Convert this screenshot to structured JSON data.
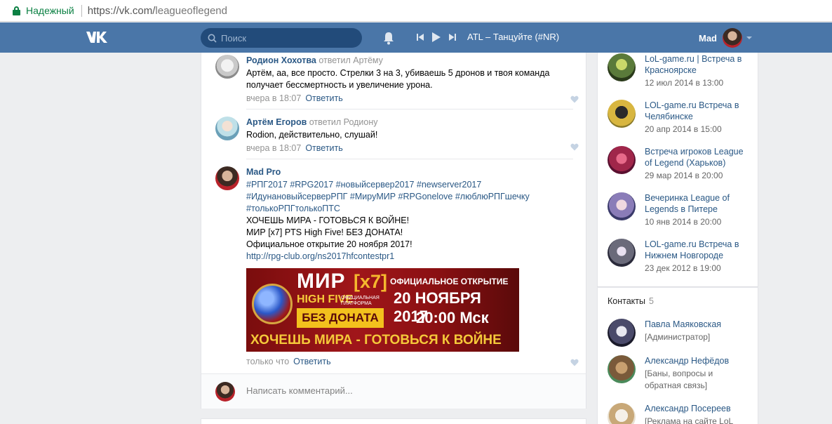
{
  "browser": {
    "secure_label": "Надежный",
    "url_host": "https://vk.com/",
    "url_path": "leagueoflegend"
  },
  "header": {
    "search_placeholder": "Поиск",
    "track": "ATL – Танцуйте (#NR)",
    "user_name": "Mad"
  },
  "comments": [
    {
      "author": "Родион Хохотва",
      "replied": "ответил Артёму",
      "lines": [
        "Артём, аа, все просто. Стрелки 3 на 3, убиваешь 5 дронов и твоя команда",
        "получает бессмертность и увеличение урона."
      ],
      "time": "вчера в 18:07",
      "reply_label": "Ответить"
    },
    {
      "author": "Артём Егоров",
      "replied": "ответил Родиону",
      "lines": [
        "Rodion, действительно, слушай!"
      ],
      "time": "вчера в 18:07",
      "reply_label": "Ответить"
    },
    {
      "author": "Mad Pro",
      "tags_line1": "#РПГ2017 #RPG2017 #новыйсервер2017 #newserver2017",
      "tags_line2": "#ИдунановыйсерверРПГ #МируМИР #RPGonelove #люблюРПГшечку",
      "tags_line3": "#толькоРПГтолькоПТС",
      "lines": [
        "ХОЧЕШЬ МИРА - ГОТОВЬСЯ К ВОЙНЕ!",
        "МИР [x7] PTS High Five! БЕЗ ДОНАТА!",
        "Официальное открытие 20 ноября 2017!"
      ],
      "link": "http://rpg-club.org/ns2017hfcontestpr1",
      "time": "только что",
      "reply_label": "Ответить"
    }
  ],
  "banner": {
    "mir": "МИР",
    "x7": "[x7]",
    "high_five": "HIGH FIVE",
    "platform": "ОФИЦИАЛЬНАЯ ПЛАТФОРМА",
    "no_donate": "БЕЗ ДОНАТА",
    "opening": "ОФИЦИАЛЬНОЕ ОТКРЫТИЕ",
    "date": "20 НОЯБРЯ 2017",
    "time": "20:00 Мск",
    "slogan": "ХОЧЕШЬ МИРА - ГОТОВЬСЯ К ВОЙНЕ"
  },
  "write_placeholder": "Написать комментарий...",
  "events": [
    {
      "title": "LoL-game.ru | Встреча в Красноярске",
      "date": "12 июл 2014 в 13:00",
      "color": "#5a7a3a"
    },
    {
      "title": "LOL-game.ru Встреча в Челябинске",
      "date": "20 апр 2014 в 15:00",
      "color": "#8a7a2a"
    },
    {
      "title": "Встреча игроков League of Legend (Харьков)",
      "date": "29 мар 2014 в 20:00",
      "color": "#a0264a"
    },
    {
      "title": "Вечеринка League of Legends в Питере",
      "date": "10 янв 2014 в 20:00",
      "color": "#8a7cb8"
    },
    {
      "title": "LOL-game.ru Встреча в Нижнем Новгороде",
      "date": "23 дек 2012 в 19:00",
      "color": "#6a6a7a"
    }
  ],
  "contacts": {
    "label": "Контакты",
    "count": "5",
    "items": [
      {
        "name": "Павла Маяковская",
        "role": "[Администратор]",
        "color": "#4a4a6a"
      },
      {
        "name": "Александр Нефёдов",
        "role": "[Баны, вопросы и обратная связь]",
        "color": "#7a5a3a"
      },
      {
        "name": "Александр Посереев",
        "role": "[Реклама на сайте LoL",
        "color": "#c8a878"
      }
    ]
  }
}
